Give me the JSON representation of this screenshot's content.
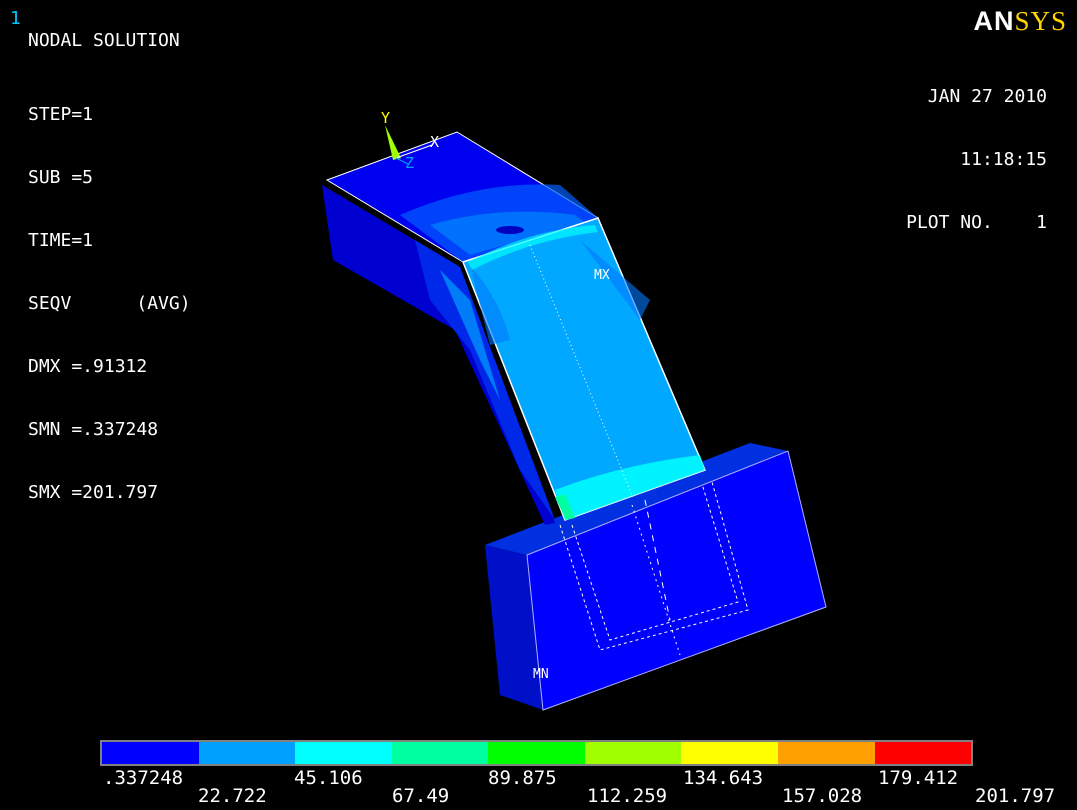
{
  "window_number": "1",
  "logo": {
    "an": "AN",
    "sys": "SYS"
  },
  "header": {
    "title": "NODAL SOLUTION",
    "lines": [
      "STEP=1",
      "SUB =5",
      "TIME=1",
      "SEQV      (AVG)",
      "DMX =.91312",
      "SMN =.337248",
      "SMX =201.797"
    ]
  },
  "date_block": {
    "date": "JAN 27 2010",
    "time": "11:18:15",
    "plot": "PLOT NO.    1"
  },
  "axis_labels": {
    "y": "Y",
    "x": "X",
    "z": "Z"
  },
  "markers": {
    "max": "MX",
    "min": "MN"
  },
  "legend": {
    "colors": [
      "#0000ff",
      "#00a0ff",
      "#00ffff",
      "#00ffa0",
      "#00ff00",
      "#a0ff00",
      "#ffff00",
      "#ffa000",
      "#ff0000"
    ],
    "upper_labels": [
      ".337248",
      "45.106",
      "89.875",
      "134.643",
      "179.412"
    ],
    "lower_labels": [
      "22.722",
      "67.49",
      "112.259",
      "157.028",
      "201.797"
    ]
  }
}
